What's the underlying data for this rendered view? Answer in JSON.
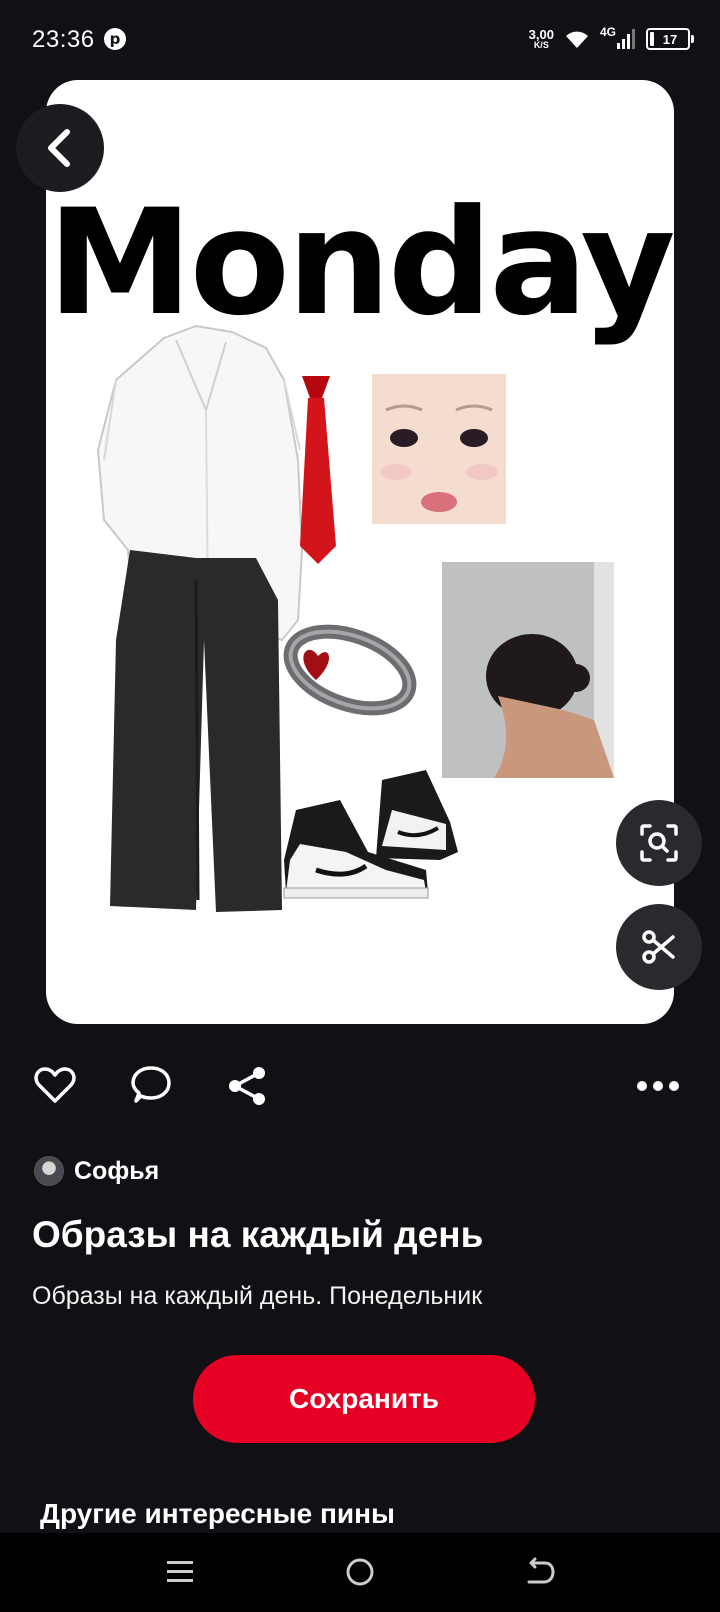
{
  "status_bar": {
    "time": "23:36",
    "net_speed_value": "3,00",
    "net_speed_unit": "K/S",
    "network_type": "4G",
    "battery_level": "17"
  },
  "pin": {
    "image_title": "Monday",
    "author": "Софья",
    "title": "Образы на каждый день",
    "description": "Образы на каждый день. Понедельник",
    "save_label": "Сохранить"
  },
  "more_section": {
    "heading": "Другие интересные пины"
  },
  "icons": {
    "back": "chevron-left-icon",
    "visual_search": "lens-icon",
    "cutout": "scissors-icon",
    "like": "heart-icon",
    "comment": "comment-icon",
    "share": "share-icon",
    "more": "ellipsis-icon"
  },
  "colors": {
    "background": "#111014",
    "accent": "#e60023",
    "card": "#ffffff"
  }
}
